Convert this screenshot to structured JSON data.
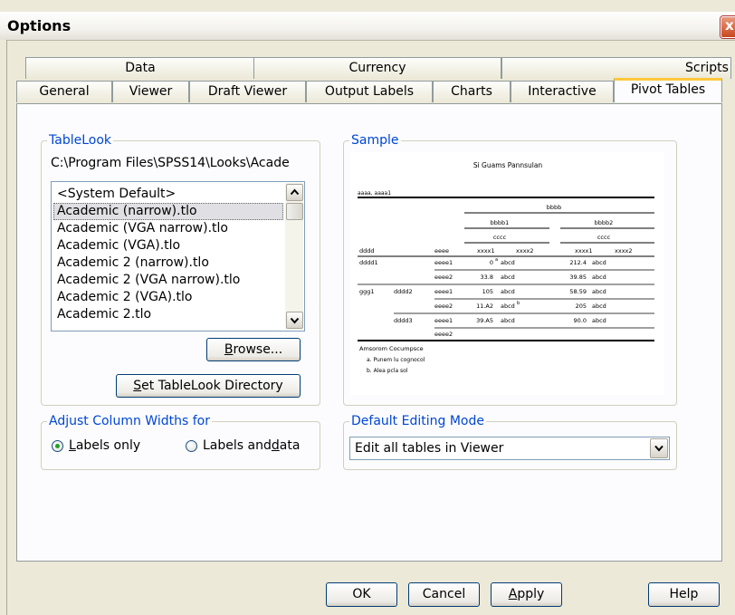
{
  "window": {
    "title": "Options",
    "close_glyph": "x"
  },
  "tabs_back_row": [
    "Data",
    "Currency",
    "Scripts"
  ],
  "tabs_front_row": [
    "General",
    "Viewer",
    "Draft Viewer",
    "Output Labels",
    "Charts",
    "Interactive",
    "Pivot Tables"
  ],
  "active_tab": "Pivot Tables",
  "tablelook": {
    "group_label": "TableLook",
    "path": "C:\\Program Files\\SPSS14\\Looks\\Acade",
    "items": [
      "<System Default>",
      "Academic (narrow).tlo",
      "Academic (VGA narrow).tlo",
      "Academic (VGA).tlo",
      "Academic 2 (narrow).tlo",
      "Academic 2 (VGA narrow).tlo",
      "Academic 2 (VGA).tlo",
      "Academic 2.tlo"
    ],
    "selected_index": 1,
    "browse_pre": "",
    "browse_u": "B",
    "browse_post": "rowse...",
    "set_dir_pre": "",
    "set_dir_u": "S",
    "set_dir_post": "et TableLook Directory"
  },
  "column_widths": {
    "group_label": "Adjust Column Widths for",
    "option1_u": "L",
    "option1_post": "abels only",
    "option2_pre": "Labels and ",
    "option2_u": "d",
    "option2_post": "ata",
    "selected": "Labels only"
  },
  "sample": {
    "group_label": "Sample",
    "table_title": "Si Guams Pannsulan",
    "corner_label": "aaaa, aaaa1",
    "h_top": "bbbb",
    "h_bbbb1": "bbbb1",
    "h_bbbb2": "bbbb2",
    "h_cccc": "cccc",
    "col_dddd": "dddd",
    "col_eeee": "eeee",
    "h_xx1": "xxxx1",
    "h_xx2": "xxxx2",
    "rows": [
      {
        "r1": "dddd1",
        "r2": "",
        "r3": "eeee1",
        "v1": "0",
        "sup1": "a",
        "a1": "abcd",
        "v2": "212.4",
        "a2": "abcd"
      },
      {
        "r1": "",
        "r2": "",
        "r3": "eeee2",
        "v1": "33.8",
        "sup1": "",
        "a1": "abcd",
        "v2": "39.85",
        "a2": "abcd"
      },
      {
        "r1": "ggg1",
        "r2": "dddd2",
        "r3": "eeee1",
        "v1": "105",
        "sup1": "",
        "a1": "abcd",
        "v2": "58.59",
        "a2": "abcd"
      },
      {
        "r1": "",
        "r2": "",
        "r3": "eeee2",
        "v1": "11.A2",
        "sup1": "",
        "a1": "abcd",
        "sup2": "b",
        "v2": "205",
        "a2": "abcd"
      },
      {
        "r1": "",
        "r2": "dddd3",
        "r3": "eeee1",
        "v1": "39.A5",
        "sup1": "",
        "a1": "abcd",
        "v2": "90.0",
        "a2": "abcd"
      },
      {
        "r1": "",
        "r2": "",
        "r3": "eeee2",
        "v1": "",
        "sup1": "",
        "a1": "",
        "v2": "",
        "a2": ""
      }
    ],
    "footnote_title": "Amsorom Cocumpsce",
    "footnote_a": "a. Punem lu cognocol",
    "footnote_b": "b. Alea pcla sol"
  },
  "editing_mode": {
    "group_label": "Default Editing Mode",
    "value": "Edit all tables in Viewer"
  },
  "bottom_buttons": {
    "ok": "OK",
    "cancel": "Cancel",
    "apply_u": "A",
    "apply_post": "pply",
    "help": "Help"
  }
}
